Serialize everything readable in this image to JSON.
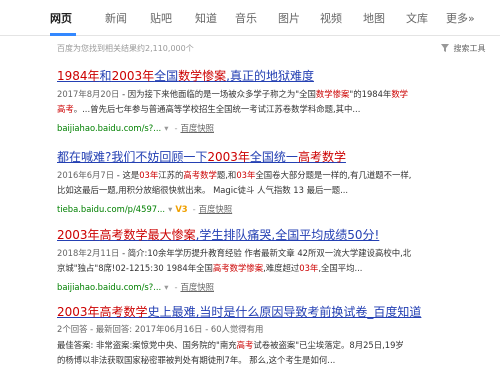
{
  "nav": {
    "tabs": [
      "网页",
      "新闻",
      "贴吧",
      "知道",
      "音乐",
      "图片",
      "视频",
      "地图",
      "文库",
      "更多»"
    ]
  },
  "stats": "百度为您找到相关结果约2,110,000个",
  "tools": "搜索工具",
  "results": [
    {
      "title_parts": [
        "1984年",
        "和",
        "2003年",
        "全国",
        "数学惨案",
        ",真正的地狱难度"
      ],
      "line1_date": "2017年8月20日",
      "line1_parts": [
        " - 因为接下来他面临的是一场被众多学子称之为\"全国",
        "数学惨案",
        "\"的1984年",
        "数学"
      ],
      "line2_parts": [
        "高考",
        "。...曾先后七年参与普通高等学校招生全国统一考试江苏卷数学科命题,其中..."
      ],
      "url": "baijiahao.baidu.com/s?...",
      "cache": "百度快照"
    },
    {
      "title_parts": [
        "都在喊难?我们不妨回顾一下",
        "2003年",
        "全国统一",
        "高考数学"
      ],
      "line1_date": "2016年6月7日",
      "line1_parts": [
        " - 这是",
        "03年",
        "江苏的",
        "高考数学",
        "题,和",
        "03年",
        "全国卷大部分题是一样的,有几道题不一样,"
      ],
      "line2_parts": [
        "比如这最后一题,用积分放缩很快就出来。 Magic徒斗 人气指数 13 最后一题..."
      ],
      "url": "tieba.baidu.com/p/4597...",
      "v3": "V3",
      "cache": "百度快照"
    },
    {
      "title_parts": [
        "2003年",
        "高考数学",
        "最大惨案",
        ",学生排队痛哭,全国平均成绩50分!"
      ],
      "line1_date": "2018年2月11日",
      "line1_parts": [
        " - 简介:10余年学历提升教育经验 作者最新文章 42所双一流大学建设高校中,北"
      ],
      "line2_parts": [
        "京城\"独占\"8席!02-1215:30 1984年全国",
        "高考数学惨案",
        ",难度超过",
        "03年",
        ",全国平均..."
      ],
      "url": "baijiahao.baidu.com/s?...",
      "cache": "百度快照"
    },
    {
      "title_parts": [
        "2003年",
        "高考数学",
        "史上最难,当时是什么原因导致考前换试卷_百度知道"
      ],
      "meta": "2个回答 - 最新回答: 2017年06月16日 - 60人觉得有用",
      "line1_parts": [
        "最佳答案: 非常盗案:案惊党中央、国务院的\"南充",
        "高考",
        "试卷被盗案\"已尘埃落定。8月25日,19岁"
      ],
      "line2_parts": [
        "的杨博以非法获取国家秘密罪被判处有期徒刑7年。 那么,这个考生是如何..."
      ]
    }
  ],
  "colors": {
    "link": "#2440b3",
    "highlight": "#c00",
    "url": "#008000",
    "accent": "#38f"
  }
}
